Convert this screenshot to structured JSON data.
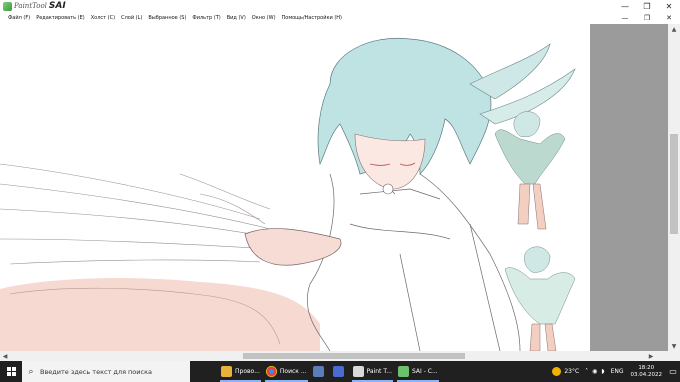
{
  "app": {
    "logo_text": "PaintTool",
    "logo_sai": "SAI",
    "window_buttons": [
      "—",
      "❐",
      "✕"
    ]
  },
  "menu": {
    "items": [
      "Файл (F)",
      "Редактировать (E)",
      "Холст (C)",
      "Слой (L)",
      "Выбранное (S)",
      "Фильтр (T)",
      "Вид (V)",
      "Окно (W)",
      "Помощь/Настройки (H)"
    ],
    "window_buttons": [
      "—",
      "❐",
      "✕"
    ]
  },
  "scrollbars": {
    "up": "▲",
    "down": "▼",
    "left": "◀",
    "right": "▶"
  },
  "taskbar": {
    "search_placeholder": "Введите здесь текст для поиска",
    "apps": [
      {
        "label": "Прово...",
        "icon": "file-explorer-icon",
        "color": "#e8b23a",
        "active": true
      },
      {
        "label": "Поиск ...",
        "icon": "chrome-icon",
        "color": "#e0453a",
        "active": true
      },
      {
        "label": "",
        "icon": "tv-icon",
        "color": "#5a7fb8",
        "active": false
      },
      {
        "label": "",
        "icon": "app-icon",
        "color": "#4a6bd0",
        "active": false
      },
      {
        "label": "Paint T...",
        "icon": "paint-tool-icon",
        "color": "#d9d9d9",
        "active": true
      },
      {
        "label": "SAI - C...",
        "icon": "sai-icon",
        "color": "#6cc06c",
        "active": true
      }
    ],
    "weather": "23°C",
    "language": "ENG",
    "time": "18:20",
    "date": "03.04.2022"
  }
}
